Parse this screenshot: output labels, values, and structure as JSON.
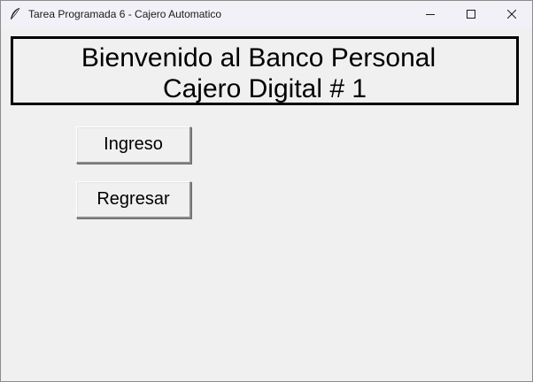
{
  "window": {
    "title": "Tarea Programada 6 - Cajero Automatico",
    "app_icon": "feather-icon",
    "controls": [
      "minimize-icon",
      "maximize-icon",
      "close-icon"
    ]
  },
  "banner": {
    "line1": "Bienvenido al Banco Personal",
    "line2": "Cajero Digital # 1"
  },
  "buttons": {
    "ingreso_label": "Ingreso",
    "regresar_label": "Regresar"
  },
  "colors": {
    "titlebar": "#f3f1f8",
    "background": "#f0f0f0",
    "banner_border": "#000000"
  }
}
